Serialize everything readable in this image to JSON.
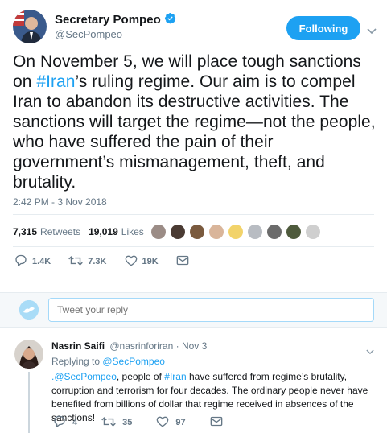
{
  "tweet": {
    "author_name": "Secretary Pompeo",
    "author_handle": "@SecPompeo",
    "follow_label": "Following",
    "text_before": "On November 5, we will place tough sanctions on ",
    "hashtag": "#Iran",
    "text_after": "’s ruling regime. Our aim is to compel Iran to abandon its destructive activities. The sanctions will target the regime—not the people, who have suffered the pain of their government’s mismanagement, theft, and brutality.",
    "timestamp": "2:42 PM - 3 Nov 2018",
    "retweets_count": "7,315",
    "retweets_label": "Retweets",
    "likes_count": "19,019",
    "likes_label": "Likes",
    "reply_count": "1.4K",
    "retweet_action_count": "7.3K",
    "like_action_count": "19K",
    "liker_colors": [
      "#9b8c86",
      "#4a3b33",
      "#7a5a3e",
      "#d9b59a",
      "#f2d36a",
      "#b8bcc2",
      "#6b6b6b",
      "#4e5a3c",
      "#cfcfcf"
    ]
  },
  "reply_box": {
    "placeholder": "Tweet your reply"
  },
  "reply": {
    "author_name": "Nasrin Saifi",
    "author_handle": "@nasrinforiran",
    "date": "· Nov 3",
    "replying_label": "Replying to ",
    "replying_to": "@SecPompeo",
    "mention": ".@SecPompeo",
    "text_1": ", people of ",
    "hashtag": "#Iran",
    "text_2": " have suffered from regime’s brutality, corruption and terrorism for four decades. The ordinary people never have benefited from billions of dollar that regime received in absences of the sanctions!",
    "reply_count": "4",
    "retweet_count": "35",
    "like_count": "97"
  },
  "colors": {
    "accent": "#1da1f2",
    "muted": "#657786",
    "text": "#14171a",
    "verified": "#1da1f2"
  }
}
